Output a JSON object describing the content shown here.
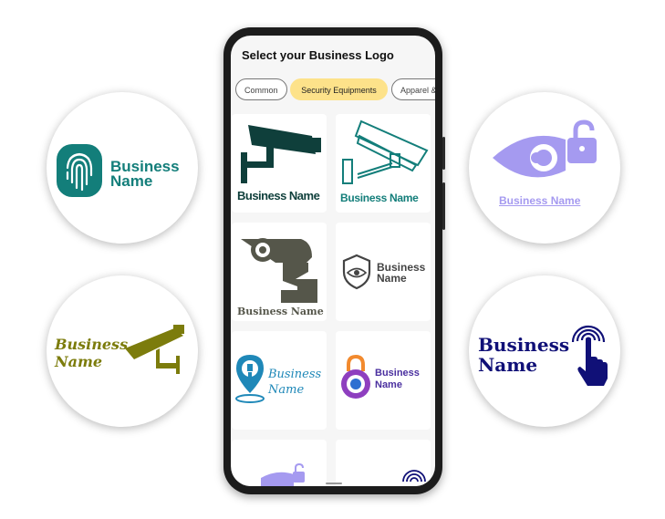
{
  "app": {
    "title": "Select your Business Logo"
  },
  "tabs": [
    {
      "label": "Common",
      "active": false
    },
    {
      "label": "Security Equipments",
      "active": true
    },
    {
      "label": "Apparel &",
      "active": false
    }
  ],
  "logo_text": "Business Name",
  "logo_word1": "Business",
  "logo_word2": "Name",
  "colors": {
    "active_tab": "#fde28a",
    "teal": "#137e7a",
    "olive": "#7c7c0c",
    "lavender": "#a59af0",
    "navy": "#101077",
    "dark_green": "#0f3f3b"
  },
  "icons": [
    "fingerprint-icon",
    "security-camera-icon",
    "eye-lock-icon",
    "touch-hand-icon",
    "shield-eye-icon",
    "location-pin-icon",
    "padlock-icon"
  ]
}
